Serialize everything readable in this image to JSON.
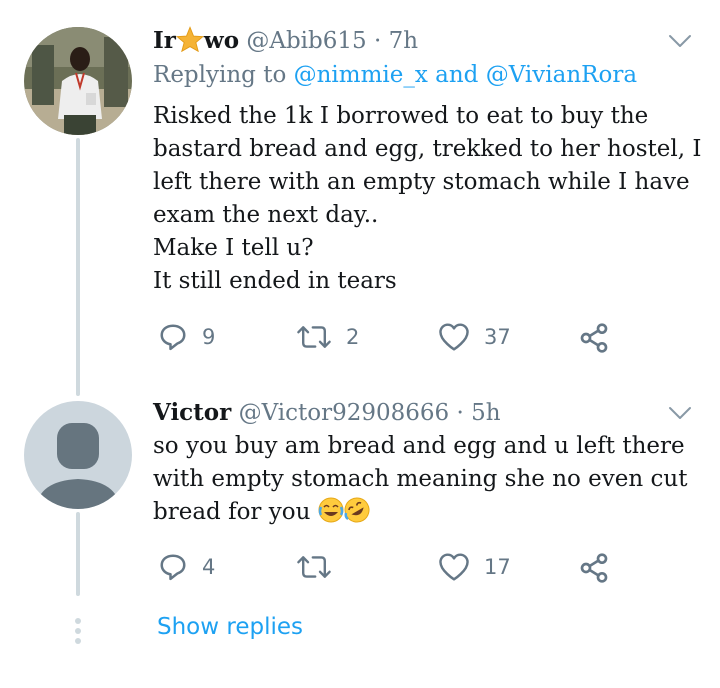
{
  "tweets": [
    {
      "name_prefix": "Ir",
      "name_suffix": "wo",
      "name_icon": "star-emoji",
      "handle": "@Abib615",
      "separator": "·",
      "time": "7h",
      "replying_prefix": "Replying to",
      "replying_mention_1": "@nimmie_x",
      "replying_and": "and",
      "replying_mention_2": "@VivianRora",
      "body_lines": [
        "Risked  the 1k I borrowed to eat to buy the",
        "bastard bread and egg, trekked to her hostel, I",
        "left there with an empty stomach while I have",
        "exam the next day..",
        "Make I tell u?",
        "It still ended in tears"
      ],
      "replies": "9",
      "retweets": "2",
      "likes": "37",
      "icons": [
        "reply-icon",
        "retweet-icon",
        "like-icon",
        "share-icon",
        "chevron-down-icon"
      ]
    },
    {
      "name": "Victor",
      "handle": "@Victor92908666",
      "separator": "·",
      "time": "5h",
      "body_lines": [
        "so you buy am bread and egg and u left there",
        "with empty stomach meaning she no even cut",
        "bread for you"
      ],
      "body_emojis": [
        "face-with-tears-of-joy-emoji",
        "rolling-on-floor-laughing-emoji"
      ],
      "replies": "4",
      "retweets": "",
      "likes": "17",
      "icons": [
        "reply-icon",
        "retweet-icon",
        "like-icon",
        "share-icon",
        "chevron-down-icon",
        "default-avatar-icon"
      ]
    }
  ],
  "show_replies_label": "Show replies",
  "colors": {
    "text": "#14171a",
    "secondary": "#657786",
    "link": "#1da1f2",
    "thread_line": "#cfd9de",
    "default_avatar_bg": "#ccd6dd",
    "default_avatar_fg": "#66757f"
  }
}
